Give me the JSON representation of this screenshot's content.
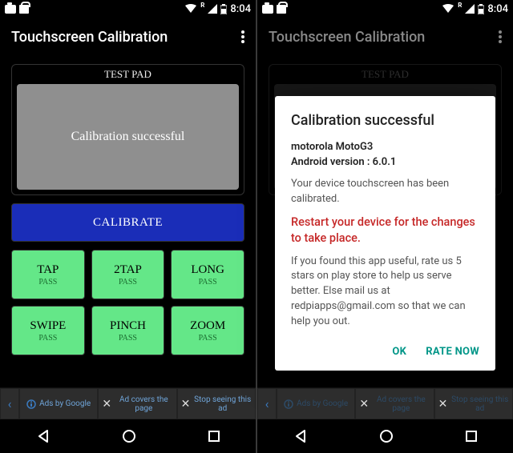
{
  "status": {
    "time": "8:04",
    "roaming_badge": "R"
  },
  "appbar": {
    "title": "Touchscreen Calibration"
  },
  "testpad": {
    "label": "TEST PAD",
    "message": "Calibration successful"
  },
  "calibrate": {
    "label": "CALIBRATE"
  },
  "tiles": [
    {
      "title": "TAP",
      "status": "PASS"
    },
    {
      "title": "2TAP",
      "status": "PASS"
    },
    {
      "title": "LONG",
      "status": "PASS"
    },
    {
      "title": "SWIPE",
      "status": "PASS"
    },
    {
      "title": "PINCH",
      "status": "PASS"
    },
    {
      "title": "ZOOM",
      "status": "PASS"
    }
  ],
  "ads": {
    "by": "Ads by Google",
    "covers": "Ad covers the page",
    "stop": "Stop seeing this ad"
  },
  "dialog": {
    "title": "Calibration successful",
    "device_name": "motorola MotoG3",
    "android_label": "Android version : ",
    "android_version": "6.0.1",
    "calibrated_msg": "Your device touchscreen has been calibrated.",
    "restart_msg": "Restart your device for the changes to take place.",
    "rate_msg": "If you found this app useful, rate us 5 stars on play store to help us serve better. Else mail us at redpiapps@gmail.com so that we can help you out.",
    "ok": "OK",
    "rate_now": "RATE NOW"
  }
}
